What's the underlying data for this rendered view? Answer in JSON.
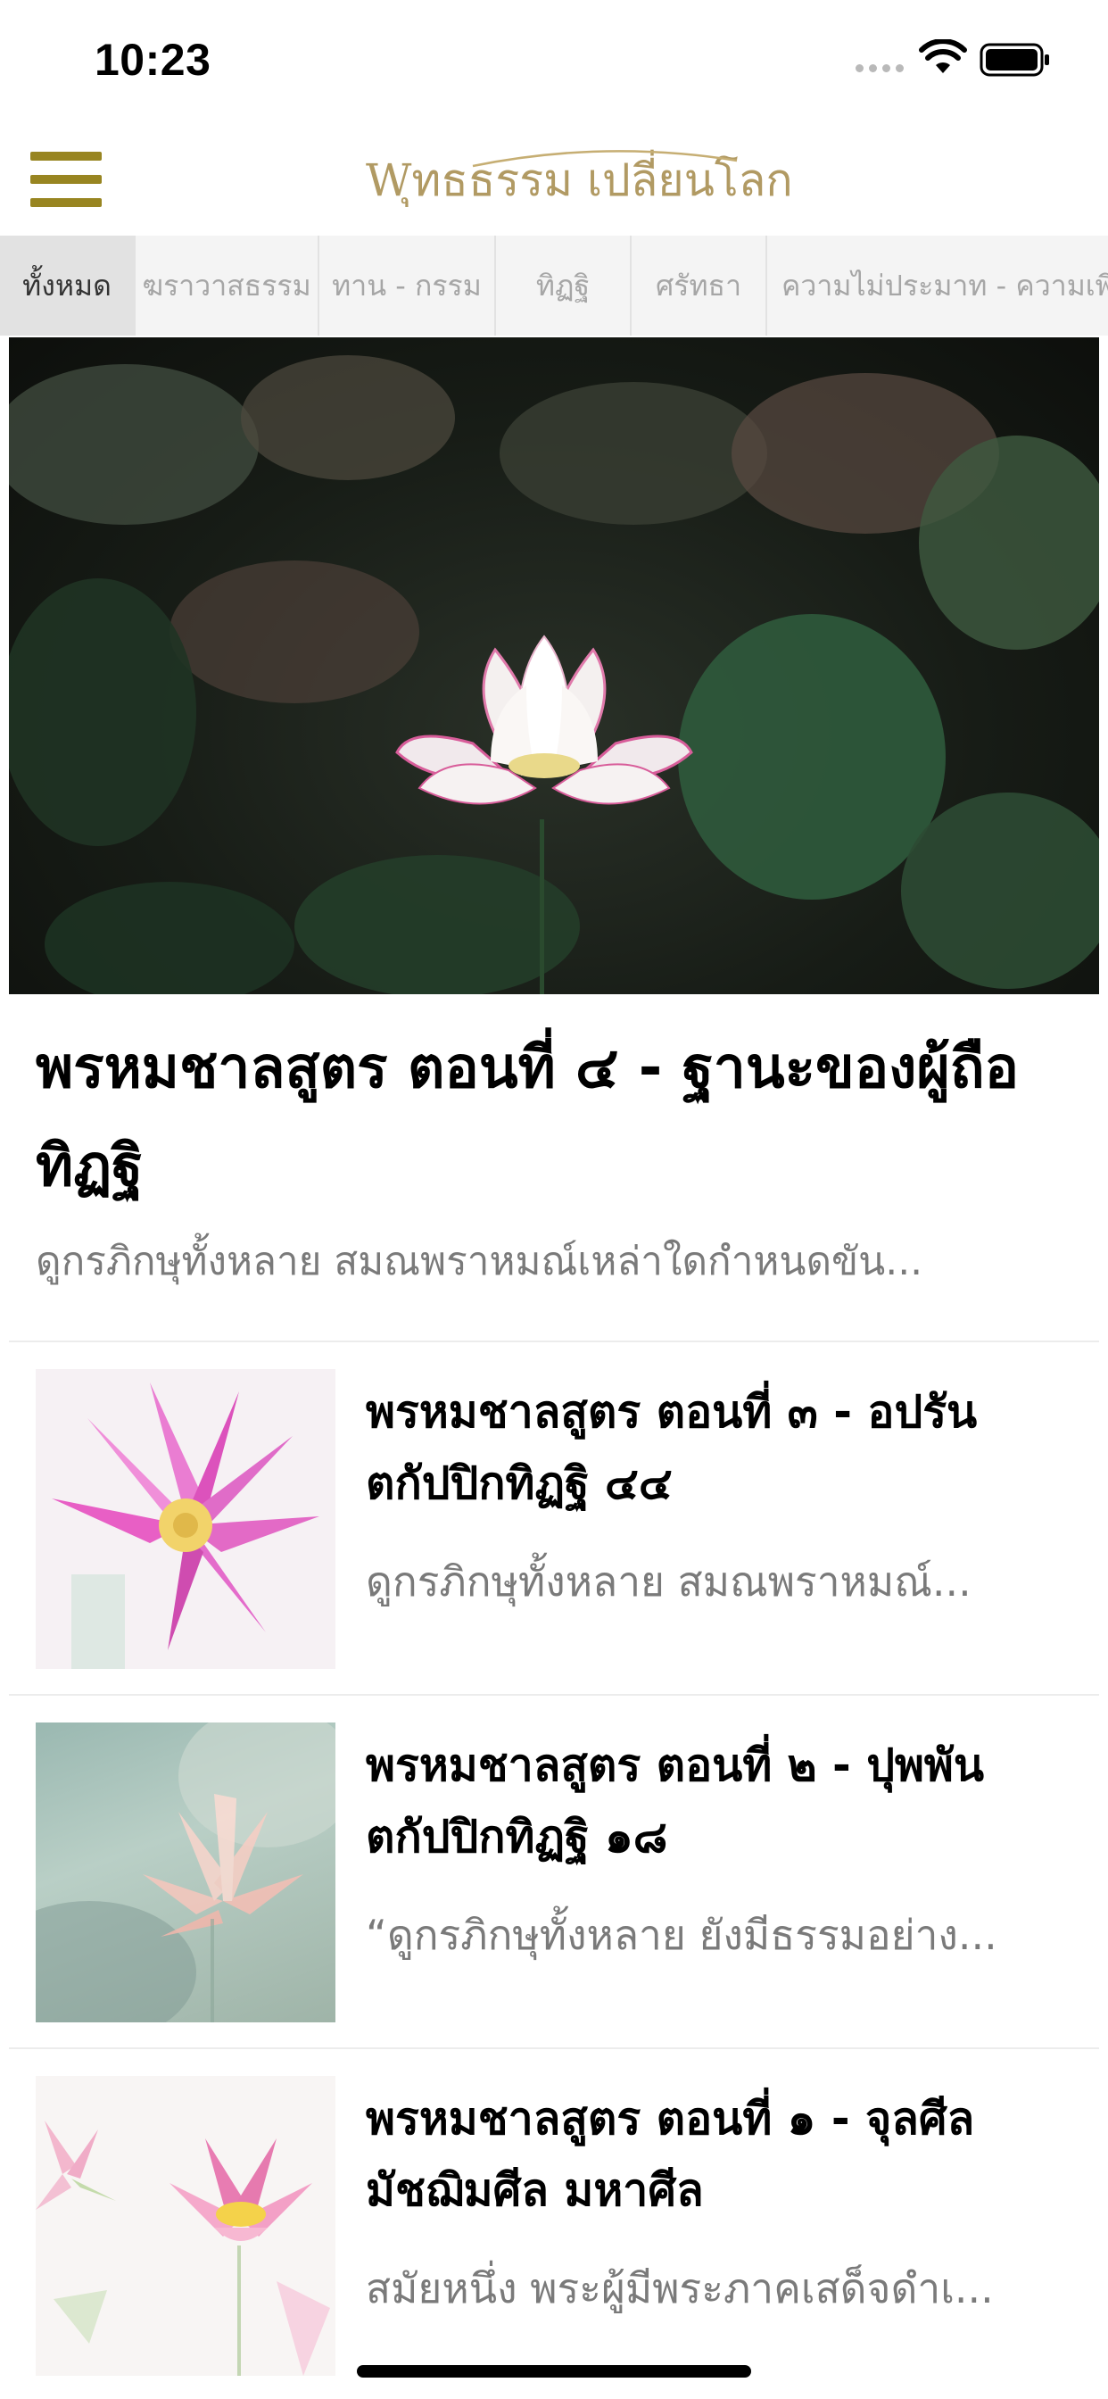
{
  "status_bar": {
    "time": "10:23",
    "icons": [
      "cellular-signal-icon",
      "wifi-icon",
      "battery-icon"
    ]
  },
  "header": {
    "menu_icon": "hamburger-menu-icon",
    "logo_text": "Wุทธธรรม เปลี่ยนโลก",
    "accent_color": "#988521"
  },
  "tabs": [
    {
      "label": "ทั้งหมด",
      "active": true
    },
    {
      "label": "ฆราวาสธรรม",
      "active": false
    },
    {
      "label": "ทาน - กรรม",
      "active": false
    },
    {
      "label": "ทิฏฐิ",
      "active": false
    },
    {
      "label": "ศรัทธา",
      "active": false
    },
    {
      "label": "ความไม่ประมาท - ความเพีย",
      "active": false
    }
  ],
  "featured": {
    "image": "white-pink-lotus-photo",
    "title": "พรหมชาลสูตร ตอนที่ ๔ - ฐานะของผู้ถือทิฏฐิ",
    "excerpt": "ดูกรภิกษุทั้งหลาย สมณพราหมณ์เหล่าใดกำหนดขัน..."
  },
  "articles": [
    {
      "image": "pink-lotus-photo",
      "title": "พรหมชาลสูตร ตอนที่ ๓ - อปรันตกัปปิกทิฏฐิ ๔๔",
      "excerpt": "ดูกรภิกษุทั้งหลาย สมณพราหมณ์..."
    },
    {
      "image": "misty-lotus-photo",
      "title": "พรหมชาลสูตร ตอนที่ ๒ - ปุพพันตกัปปิกทิฏฐิ ๑๘",
      "excerpt": "“ดูกรภิกษุทั้งหลาย ยังมีธรรมอย่าง..."
    },
    {
      "image": "watercolor-lotus-photo",
      "title": "พรหมชาลสูตร ตอนที่ ๑ - จุลศีล มัชฌิมศีล มหาศีล",
      "excerpt": "สมัยหนึ่ง พระผู้มีพระภาคเสด็จดำเ..."
    }
  ]
}
